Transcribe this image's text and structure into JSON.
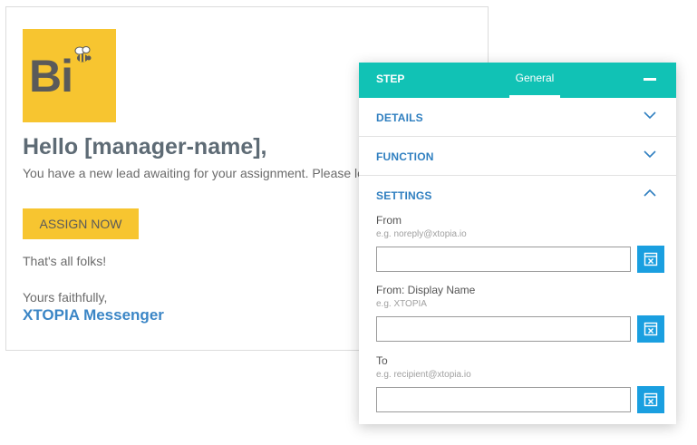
{
  "email": {
    "logo_text": "Bi",
    "greeting": "Hello [manager-name],",
    "intro": "You have a new lead awaiting for your assignment. Please login to Busy Bee.",
    "button_label": "ASSIGN NOW",
    "closing": "That's all folks!",
    "signoff": "Yours faithfully,",
    "signature": "XTOPIA Messenger",
    "colors": {
      "brand_yellow": "#f7c530",
      "signature_blue": "#3b86c6"
    }
  },
  "panel": {
    "header": {
      "step_label": "STEP",
      "active_tab": "General",
      "minimize_icon": "minus-icon"
    },
    "sections": [
      {
        "label": "DETAILS",
        "icon": "chevron-down-icon"
      },
      {
        "label": "FUNCTION",
        "icon": "chevron-down-icon"
      },
      {
        "label": "SETTINGS",
        "icon": "chevron-up-icon"
      }
    ],
    "fields": [
      {
        "label": "From",
        "hint": "e.g. noreply@xtopia.io",
        "value": "",
        "button_icon": "variable-picker-icon"
      },
      {
        "label": "From: Display Name",
        "hint": "e.g. XTOPIA",
        "value": "",
        "button_icon": "variable-picker-icon"
      },
      {
        "label": "To",
        "hint": "e.g. recipient@xtopia.io",
        "value": "",
        "button_icon": "variable-picker-icon"
      }
    ],
    "colors": {
      "header_teal": "#11c2b5",
      "section_blue": "#2f7fc0",
      "button_blue": "#1a9fe0"
    }
  }
}
